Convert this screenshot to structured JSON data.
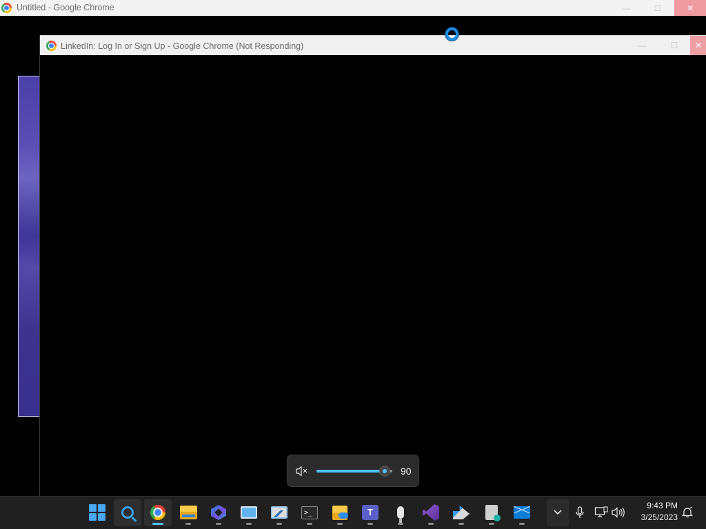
{
  "background_window": {
    "title": "Untitled - Google Chrome",
    "minimize_glyph": "—",
    "maximize_glyph": "☐",
    "close_glyph": "✕"
  },
  "foreground_window": {
    "title": "LinkedIn: Log In or Sign Up - Google Chrome (Not Responding)",
    "minimize_glyph": "—",
    "maximize_glyph": "☐",
    "close_glyph": "✕",
    "close_color": "#ef9ea4"
  },
  "volume_flyout": {
    "value": "90",
    "level_percent": 90,
    "accent": "#4cc2ff"
  },
  "taskbar": {
    "apps": [
      {
        "name": "start",
        "icon": "windows-logo-icon",
        "running": false
      },
      {
        "name": "search",
        "icon": "search-icon",
        "running": false,
        "active": true
      },
      {
        "name": "google-chrome",
        "icon": "chrome-icon",
        "running": true,
        "focused": true,
        "active": true
      },
      {
        "name": "file-explorer",
        "icon": "folder-icon",
        "running": true
      },
      {
        "name": "copilot",
        "icon": "copilot-icon",
        "running": true
      },
      {
        "name": "remote-desktop",
        "icon": "remote-desktop-icon",
        "running": true
      },
      {
        "name": "performance-monitor",
        "icon": "performance-monitor-icon",
        "running": true
      },
      {
        "name": "terminal",
        "icon": "terminal-icon",
        "running": true,
        "text": ">_"
      },
      {
        "name": "onedrive-folder",
        "icon": "onedrive-folder-icon",
        "running": true
      },
      {
        "name": "microsoft-teams",
        "icon": "teams-icon",
        "running": true,
        "text": "T"
      },
      {
        "name": "voice-recorder",
        "icon": "microphone-icon",
        "running": true
      },
      {
        "name": "visual-studio",
        "icon": "visual-studio-icon",
        "running": true
      },
      {
        "name": "developer-tools",
        "icon": "tools-icon",
        "running": true
      },
      {
        "name": "backup-app",
        "icon": "backup-icon",
        "running": true
      },
      {
        "name": "mail",
        "icon": "mail-icon",
        "running": true
      }
    ]
  },
  "tray": {
    "chevron_glyph": "⌄",
    "mic_glyph": "🎙",
    "network_glyph": "🖧",
    "volume_glyph": "🔊",
    "notification_glyph": "🔔",
    "time": "9:43 PM",
    "date": "3/25/2023"
  }
}
